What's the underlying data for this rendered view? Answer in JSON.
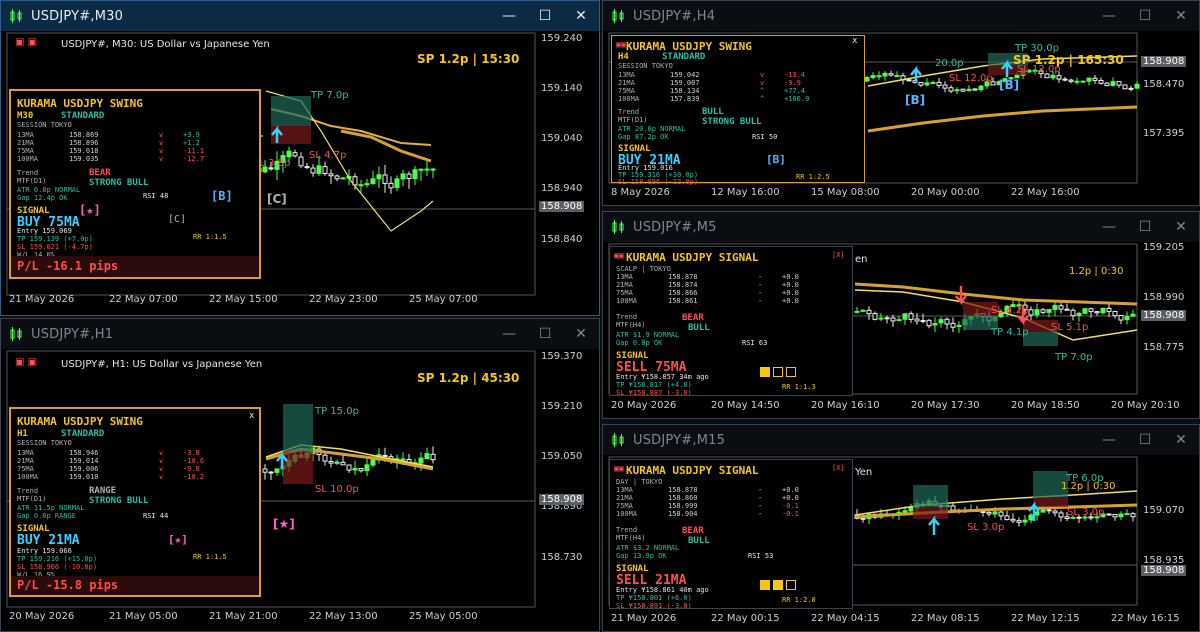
{
  "icons": {
    "chart": "candlestick-chart-icon",
    "minimize": "minimize-icon",
    "maximize": "maximize-icon",
    "close": "close-icon"
  },
  "colors": {
    "bull": "#4cff4c",
    "bear": "#ffffff",
    "gold": "#f5c518",
    "cyan": "#39d0ff",
    "red": "#ff4d4d",
    "teal": "#26c0a4"
  },
  "windows": {
    "m30": {
      "title": "USDJPY#,M30",
      "caption": "USDJPY#, M30:  US Dollar vs Japanese Yen",
      "spread_label": "SP 1.2p  |  15:30",
      "price_scale": [
        "159.240",
        "159.140",
        "159.040",
        "158.940",
        "158.840"
      ],
      "current_price": "158.908",
      "time_axis": [
        "21 May 2026",
        "22 May 07:00",
        "22 May 15:00",
        "22 May 23:00",
        "25 May 07:00"
      ],
      "tp_label": "TP 7.0p",
      "sl1": "SL 3.8p",
      "sl2": "SL 4.7p",
      "c_marker": "[C]",
      "panel": {
        "title": "KURAMA USDJPY SWING",
        "tf": "M30",
        "mode": "STANDARD",
        "session": "SESSION  TOKYO",
        "ma_rows": [
          {
            "name": "13MA",
            "value": "158.869",
            "dir": "v",
            "delta": "+3.9"
          },
          {
            "name": "21MA",
            "value": "158.896",
            "dir": "v",
            "delta": "+1.2"
          },
          {
            "name": "75MA",
            "value": "159.018",
            "dir": "v",
            "delta": "-11.1"
          },
          {
            "name": "100MA",
            "value": "159.035",
            "dir": "v",
            "delta": "-12.7"
          }
        ],
        "trend_label": "Trend",
        "mtf": "MTF(D1)",
        "trend1": "BEAR",
        "trend2": "STRONG BULL",
        "atr": "ATR  6.8p  NORMAL",
        "gap": "Gap 12.4p OK",
        "rsi": "RSI 48",
        "b_marker": "[B]",
        "star_marker": "[★]",
        "signal_label": "SIGNAL",
        "signal": "BUY  75MA",
        "c_tag": "[C]",
        "entry": "Entry  159.069",
        "tp": "TP  159.139 (+7.0p)",
        "sl": "SL  159.021 (-4.7p)",
        "wl": "W/L 14.0%",
        "rr": "RR 1:1.5",
        "pl": "P/L  -16.1 pips"
      }
    },
    "h1": {
      "title": "USDJPY#,H1",
      "caption": "USDJPY#, H1:  US Dollar vs Japanese Yen",
      "spread_label": "SP 1.2p  |  45:30",
      "price_scale": [
        "159.370",
        "159.210",
        "159.050",
        "158.890",
        "158.730"
      ],
      "current_price": "158.908",
      "time_axis": [
        "20 May 2026",
        "21 May 05:00",
        "21 May 21:00",
        "22 May 13:00",
        "25 May 05:00"
      ],
      "tp_label": "TP 15.0p",
      "sl_label": "SL 10.0p",
      "star_chart": "[★]",
      "panel": {
        "title": "KURAMA USDJPY SWING",
        "tf": "H1",
        "mode": "STANDARD",
        "session": "SESSION  TOKYO",
        "close": "x",
        "ma_rows": [
          {
            "name": "13MA",
            "value": "158.946",
            "dir": "v",
            "delta": "-3.8"
          },
          {
            "name": "21MA",
            "value": "159.014",
            "dir": "v",
            "delta": "-10.6"
          },
          {
            "name": "75MA",
            "value": "159.006",
            "dir": "v",
            "delta": "-9.8"
          },
          {
            "name": "100MA",
            "value": "159.010",
            "dir": "v",
            "delta": "-10.2"
          }
        ],
        "trend_label": "Trend",
        "mtf": "MTF(D1)",
        "trend1": "RANGE",
        "trend2": "STRONG BULL",
        "atr": "ATR  11.5p  NORMAL",
        "gap": "Gap 0.8p RANGE",
        "rsi": "RSI 44",
        "signal_label": "SIGNAL",
        "signal": "BUY  21MA",
        "star_marker": "[★]",
        "entry": "Entry  159.066",
        "tp": "TP  159.216 (+15.0p)",
        "sl": "SL  158.966 (-10.0p)",
        "wl": "W/L 16.9%",
        "rr": "RR 1:1.5",
        "pl": "P/L  -15.8 pips"
      }
    },
    "h4": {
      "title": "USDJPY#,H4",
      "spread_label": "SP 1.2p  |  165:30",
      "price_scale": [
        "158.470",
        "157.395"
      ],
      "current_price": "158.908",
      "time_axis": [
        "8 May 2026",
        "12 May 16:00",
        "15 May 08:00",
        "20 May 00:00",
        "22 May 16:00"
      ],
      "tp_label": "TP 30.0p",
      "tp2_label": "20.0p",
      "sl_label": "SL 12.0p",
      "sl2_label": "SL 12.0p",
      "b_chart1": "[B]",
      "b_chart2": "[B]",
      "panel": {
        "title": "KURAMA USDJPY SWING",
        "tf": "H4",
        "mode": "STANDARD",
        "session": "SESSION  TOKYO",
        "close": "x",
        "ma_rows": [
          {
            "name": "13MA",
            "value": "159.042",
            "dir": "v",
            "delta": "-13.4"
          },
          {
            "name": "21MA",
            "value": "159.007",
            "dir": "v",
            "delta": "-9.9"
          },
          {
            "name": "75MA",
            "value": "158.134",
            "dir": "^",
            "delta": "+77.4"
          },
          {
            "name": "100MA",
            "value": "157.839",
            "dir": "^",
            "delta": "+106.9"
          }
        ],
        "trend_label": "Trend",
        "mtf": "MTF(D1)",
        "trend1": "BULL",
        "trend2": "STRONG BULL",
        "atr": "ATR  20.6p  NORMAL",
        "gap": "Gap 87.2p OK",
        "rsi": "RSI 50",
        "signal_label": "SIGNAL",
        "signal": "BUY  21MA",
        "b_marker": "[B]",
        "entry": "Entry  159.016",
        "tp": "TP  159.316 (+30.0p)",
        "sl": "SL  158.896 (-12.0p)",
        "rr": "RR 1:2.5"
      }
    },
    "m5": {
      "title": "USDJPY#,M5",
      "spread_label": "1.2p  |  0:30",
      "caption_tail": "en",
      "price_scale": [
        "159.205",
        "158.990",
        "158.775"
      ],
      "current_price": "158.908",
      "time_axis": [
        "20 May 2026",
        "20 May 14:50",
        "20 May 16:10",
        "20 May 17:30",
        "20 May 18:50",
        "20 May 20:10"
      ],
      "sl1": "SL 4.2p",
      "sl2": "SL 5.1p",
      "tp1": "TP 4.1p",
      "tp2": "TP 7.0p",
      "panel": {
        "title": "KURAMA USDJPY SIGNAL",
        "close": "[X]",
        "mode": "SCALP | TOKYO",
        "ma_rows": [
          {
            "name": "13MA",
            "value": "158.878",
            "dir": "-",
            "delta": "+0.0"
          },
          {
            "name": "21MA",
            "value": "158.874",
            "dir": "-",
            "delta": "+0.0"
          },
          {
            "name": "75MA",
            "value": "158.866",
            "dir": "-",
            "delta": "+0.0"
          },
          {
            "name": "100MA",
            "value": "158.861",
            "dir": "-",
            "delta": "+0.0"
          }
        ],
        "trend_label": "Trend",
        "mtf": "MTF(H4)",
        "trend1": "BEAR",
        "trend2": "BULL",
        "atr": "ATR $1.9 NORMAL",
        "gap": "Gap 0.8p OK",
        "rsi": "RSI 63",
        "signal_label": "SIGNAL",
        "signal": "SELL  75MA",
        "entry": "Entry ¥158.857   34m ago",
        "tp": "TP ¥158.817 (+4.0)",
        "sl": "SL ¥158.887 (-3.0)",
        "rr": "RR 1:1.3",
        "squares": [
          true,
          false,
          false
        ]
      }
    },
    "m15": {
      "title": "USDJPY#,M15",
      "caption_tail": "Yen",
      "spread_label": "1.2p  |  0:30",
      "price_scale": [
        "159.070",
        "158.935"
      ],
      "current_price": "158.908",
      "time_axis": [
        "21 May 2026",
        "22 May 00:15",
        "22 May 04:15",
        "22 May 08:15",
        "22 May 12:15",
        "22 May 16:15"
      ],
      "tp_label": "TP 6.0p",
      "sl1": "SL 3.0p",
      "sl2": "SL 3.0p",
      "panel": {
        "title": "KURAMA USDJPY SIGNAL",
        "close": "[X]",
        "mode": "DAY | TOKYO",
        "ma_rows": [
          {
            "name": "13MA",
            "value": "158.878",
            "dir": "-",
            "delta": "+0.0"
          },
          {
            "name": "21MA",
            "value": "158.860",
            "dir": "-",
            "delta": "+0.0"
          },
          {
            "name": "75MA",
            "value": "158.999",
            "dir": "-",
            "delta": "-0.1"
          },
          {
            "name": "100MA",
            "value": "158.904",
            "dir": "-",
            "delta": "-0.1"
          }
        ],
        "trend_label": "Trend",
        "mtf": "MTF(H4)",
        "trend1": "BEAR",
        "trend2": "BULL",
        "atr": "ATR $3.2 NORMAL",
        "gap": "Gap 13.9p OK",
        "rsi": "RSI 53",
        "signal_label": "SIGNAL",
        "signal": "SELL  21MA",
        "entry": "Entry ¥158.861   40m ago",
        "tp": "TP ¥158.801 (+6.0)",
        "sl": "SL ¥158.891 (-3.0)",
        "rr": "RR 1:2.0",
        "squares": [
          true,
          true,
          false
        ]
      }
    }
  }
}
